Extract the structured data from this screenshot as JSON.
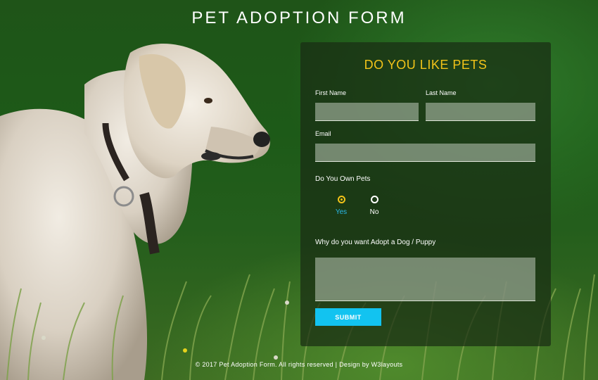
{
  "page": {
    "title": "PET ADOPTION FORM",
    "footer": "© 2017 Pet Adoption Form. All rights reserved | Design by W3layouts"
  },
  "form": {
    "heading": "DO YOU LIKE PETS",
    "first_name_label": "First Name",
    "first_name_value": "",
    "last_name_label": "Last Name",
    "last_name_value": "",
    "email_label": "Email",
    "email_value": "",
    "own_pets_label": "Do You Own Pets",
    "own_pets_options": [
      "Yes",
      "No"
    ],
    "own_pets_selected": "Yes",
    "reason_label": "Why do you want Adopt a Dog / Puppy",
    "reason_value": "",
    "submit_label": "SUBMIT"
  },
  "colors": {
    "heading": "#f2c319",
    "submit_bg": "#12c3f0",
    "selected_option": "#29b8e8",
    "background": "#1f5418"
  }
}
